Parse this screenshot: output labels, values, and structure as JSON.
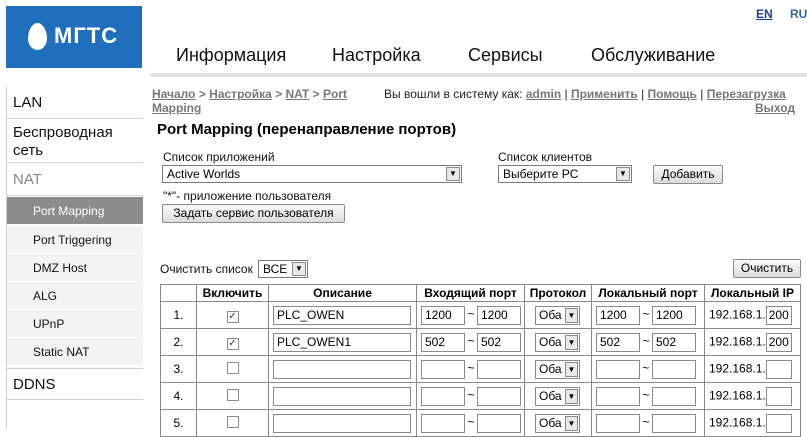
{
  "brand": {
    "name": "МГТС"
  },
  "lang": {
    "en": "EN",
    "ru": "RU"
  },
  "topnav": [
    "Информация",
    "Настройка",
    "Сервисы",
    "Обслуживание"
  ],
  "sidebar": {
    "lan": "LAN",
    "wireless": "Беспроводная сеть",
    "nat": "NAT",
    "nat_items": [
      "Port Mapping",
      "Port Triggering",
      "DMZ Host",
      "ALG",
      "UPnP",
      "Static NAT"
    ],
    "ddns": "DDNS"
  },
  "breadcrumb": {
    "home": "Начало",
    "settings": "Настройка",
    "nat": "NAT",
    "page": "Port Mapping"
  },
  "login": {
    "prefix": "Вы вошли в систему как:",
    "user": "admin",
    "apply": "Применить",
    "help": "Помощь",
    "reboot": "Перезагрузка",
    "logout": "Выход"
  },
  "title": "Port Mapping (перенаправление портов)",
  "apps": {
    "label": "Список приложений",
    "selected": "Active Worlds",
    "note": "\"*\"- приложение пользователя",
    "user_service_button": "Задать сервис пользователя"
  },
  "clients": {
    "label": "Список клиентов",
    "selected": "Выберите PC",
    "add_button": "Добавить"
  },
  "clear": {
    "label": "Очистить список",
    "selected": "ВСЕ",
    "button": "Очистить"
  },
  "table": {
    "headers": [
      "",
      "Включить",
      "Описание",
      "Входящий порт",
      "Протокол",
      "Локальный порт",
      "Локальный IP"
    ],
    "rows": [
      {
        "num": "1.",
        "checked": true,
        "desc": "PLC_OWEN",
        "in_from": "1200",
        "in_to": "1200",
        "proto": "Оба",
        "loc_from": "1200",
        "loc_to": "1200",
        "ip_prefix": "192.168.1.",
        "ip_last": "200"
      },
      {
        "num": "2.",
        "checked": true,
        "desc": "PLC_OWEN1",
        "in_from": "502",
        "in_to": "502",
        "proto": "Оба",
        "loc_from": "502",
        "loc_to": "502",
        "ip_prefix": "192.168.1.",
        "ip_last": "200"
      },
      {
        "num": "3.",
        "checked": false,
        "desc": "",
        "in_from": "",
        "in_to": "",
        "proto": "Оба",
        "loc_from": "",
        "loc_to": "",
        "ip_prefix": "192.168.1.",
        "ip_last": ""
      },
      {
        "num": "4.",
        "checked": false,
        "desc": "",
        "in_from": "",
        "in_to": "",
        "proto": "Оба",
        "loc_from": "",
        "loc_to": "",
        "ip_prefix": "192.168.1.",
        "ip_last": ""
      },
      {
        "num": "5.",
        "checked": false,
        "desc": "",
        "in_from": "",
        "in_to": "",
        "proto": "Оба",
        "loc_from": "",
        "loc_to": "",
        "ip_prefix": "192.168.1.",
        "ip_last": ""
      }
    ]
  },
  "colors": {
    "brand_blue": "#1f6fbd",
    "active_menu": "#8c8c8c"
  }
}
